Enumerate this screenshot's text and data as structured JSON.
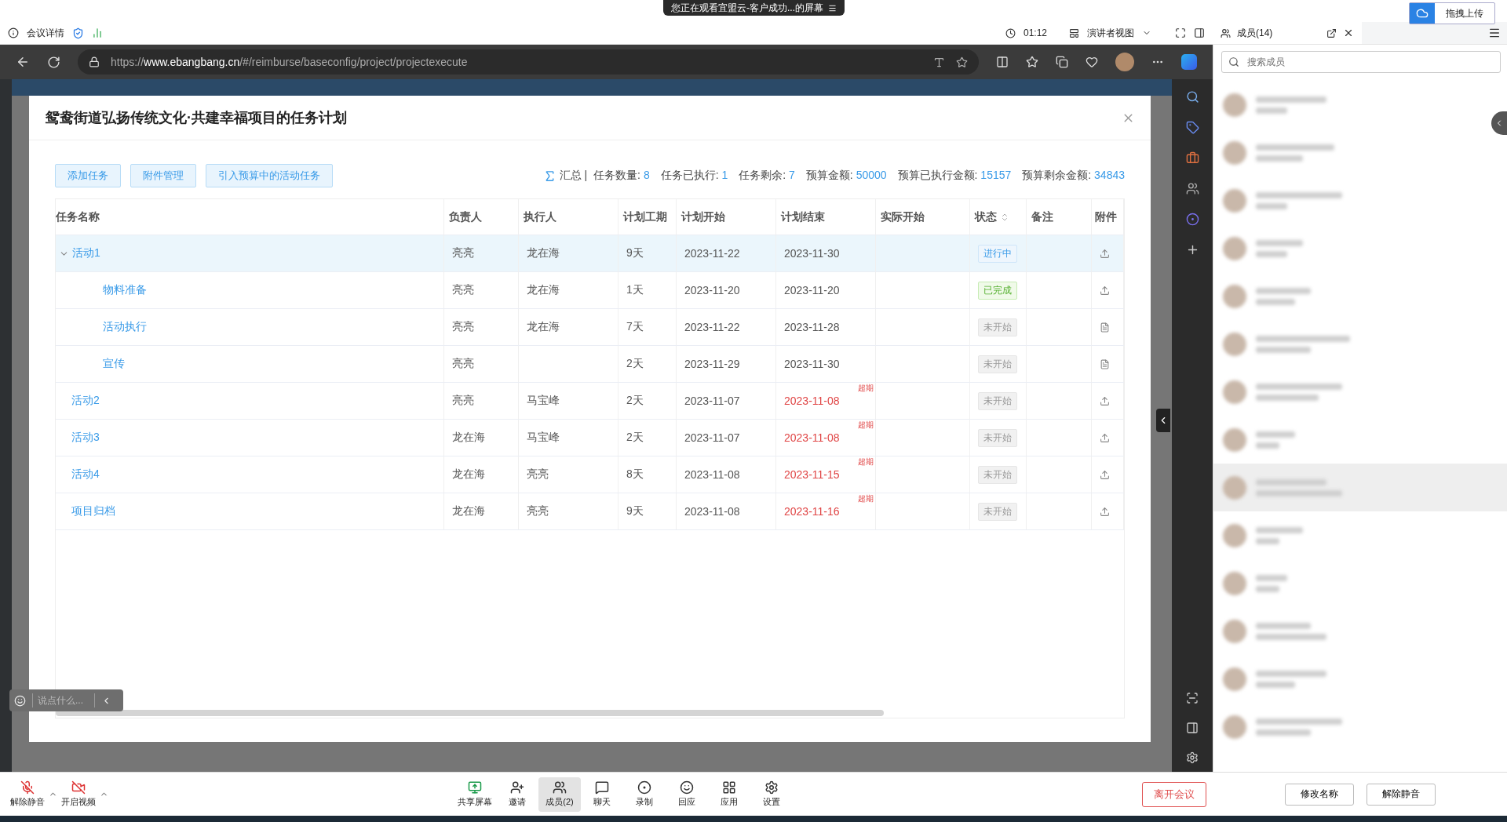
{
  "meeting_bar": {
    "info_label": "会议详情",
    "share_banner": "您正在观看宜盟云-客户成功...的屏幕",
    "timer": "01:12",
    "view_mode": "演讲者视图"
  },
  "upload_button": "拖拽上传",
  "browser": {
    "url": "https://**www.ebangbang.cn**/#/reimburse/baseconfig/project/projectexecute"
  },
  "dialog": {
    "title": "鸳鸯街道弘扬传统文化·共建幸福项目的任务计划",
    "actions": [
      "添加任务",
      "附件管理",
      "引入预算中的活动任务"
    ],
    "summary": {
      "label": "汇总 | ",
      "items": [
        {
          "label": "任务数量: ",
          "value": "8"
        },
        {
          "label": "任务已执行: ",
          "value": "1"
        },
        {
          "label": "任务剩余: ",
          "value": "7"
        },
        {
          "label": "预算金额: ",
          "value": "50000"
        },
        {
          "label": "预算已执行金额: ",
          "value": "15157"
        },
        {
          "label": "预算剩余金额: ",
          "value": "34843"
        }
      ]
    },
    "columns": [
      {
        "label": "任务名称",
        "sortable": false
      },
      {
        "label": "负责人",
        "sortable": false
      },
      {
        "label": "执行人",
        "sortable": false
      },
      {
        "label": "计划工期",
        "sortable": false
      },
      {
        "label": "计划开始",
        "sortable": false
      },
      {
        "label": "计划结束",
        "sortable": false
      },
      {
        "label": "实际开始",
        "sortable": false
      },
      {
        "label": "状态",
        "sortable": true
      },
      {
        "label": "备注",
        "sortable": false
      },
      {
        "label": "附件",
        "sortable": false
      }
    ],
    "rows": [
      {
        "name": "活动1",
        "owner": "亮亮",
        "executor": "龙在海",
        "duration": "9天",
        "start": "2023-11-22",
        "end": "2023-11-30",
        "overdue": false,
        "status": {
          "label": "进行中",
          "kind": "progress"
        },
        "attachment": {
          "kind": "upload"
        },
        "selected": true,
        "expanded": true,
        "children": [
          {
            "name": "物料准备",
            "owner": "亮亮",
            "executor": "龙在海",
            "duration": "1天",
            "start": "2023-11-20",
            "end": "2023-11-20",
            "overdue": false,
            "status": {
              "label": "已完成",
              "kind": "done"
            },
            "attachment": {
              "kind": "upload"
            },
            "selected": false
          },
          {
            "name": "活动执行",
            "owner": "亮亮",
            "executor": "龙在海",
            "duration": "7天",
            "start": "2023-11-22",
            "end": "2023-11-28",
            "overdue": false,
            "status": {
              "label": "未开始",
              "kind": "pending"
            },
            "attachment": {
              "kind": "file"
            },
            "selected": false
          },
          {
            "name": "宣传",
            "owner": "亮亮",
            "duration": "2天",
            "start": "2023-11-29",
            "end": "2023-11-30",
            "overdue": false,
            "status": {
              "label": "未开始",
              "kind": "pending"
            },
            "attachment": {
              "kind": "file"
            },
            "selected": false
          }
        ]
      },
      {
        "name": "活动2",
        "owner": "亮亮",
        "executor": "马宝峰",
        "duration": "2天",
        "start": "2023-11-07",
        "end": "2023-11-08",
        "overdue": true,
        "overdue_label": "超期",
        "status": {
          "label": "未开始",
          "kind": "pending"
        },
        "attachment": {
          "kind": "upload"
        },
        "selected": false
      },
      {
        "name": "活动3",
        "owner": "龙在海",
        "executor": "马宝峰",
        "duration": "2天",
        "start": "2023-11-07",
        "end": "2023-11-08",
        "overdue": true,
        "overdue_label": "超期",
        "status": {
          "label": "未开始",
          "kind": "pending"
        },
        "attachment": {
          "kind": "upload"
        },
        "selected": false
      },
      {
        "name": "活动4",
        "owner": "龙在海",
        "executor": "亮亮",
        "duration": "8天",
        "start": "2023-11-08",
        "end": "2023-11-15",
        "overdue": true,
        "overdue_label": "超期",
        "status": {
          "label": "未开始",
          "kind": "pending"
        },
        "attachment": {
          "kind": "upload"
        },
        "selected": false
      },
      {
        "name": "项目归档",
        "owner": "龙在海",
        "executor": "亮亮",
        "duration": "9天",
        "start": "2023-11-08",
        "end": "2023-11-16",
        "overdue": true,
        "overdue_label": "超期",
        "status": {
          "label": "未开始",
          "kind": "pending"
        },
        "attachment": {
          "kind": "upload"
        },
        "selected": false
      }
    ]
  },
  "chat_input": {
    "placeholder": "说点什么..."
  },
  "members_panel": {
    "title": "成员(14)",
    "search_placeholder": "搜索成员",
    "buttons": [
      "修改名称",
      "解除静音"
    ],
    "members": [
      {
        "selected": false
      },
      {
        "selected": false
      },
      {
        "selected": false
      },
      {
        "selected": false
      },
      {
        "selected": false
      },
      {
        "selected": false
      },
      {
        "selected": false
      },
      {
        "selected": false
      },
      {
        "selected": true
      },
      {
        "selected": false
      },
      {
        "selected": false
      },
      {
        "selected": false
      },
      {
        "selected": false
      },
      {
        "selected": false
      }
    ]
  },
  "toolbar": {
    "left": [
      {
        "label": "解除静音",
        "kind": "mic"
      },
      {
        "label": "开启视频",
        "kind": "video"
      }
    ],
    "center": [
      {
        "label": "共享屏幕",
        "kind": "share",
        "selected": false
      },
      {
        "label": "邀请",
        "kind": "invite",
        "selected": false
      },
      {
        "label": "成员(2)",
        "kind": "members",
        "selected": true
      },
      {
        "label": "聊天",
        "kind": "chat",
        "selected": false
      },
      {
        "label": "录制",
        "kind": "record",
        "selected": false
      },
      {
        "label": "回应",
        "kind": "react",
        "selected": false
      },
      {
        "label": "应用",
        "kind": "apps",
        "selected": false
      },
      {
        "label": "设置",
        "kind": "settings",
        "selected": false
      }
    ],
    "leave": "离开会议"
  }
}
